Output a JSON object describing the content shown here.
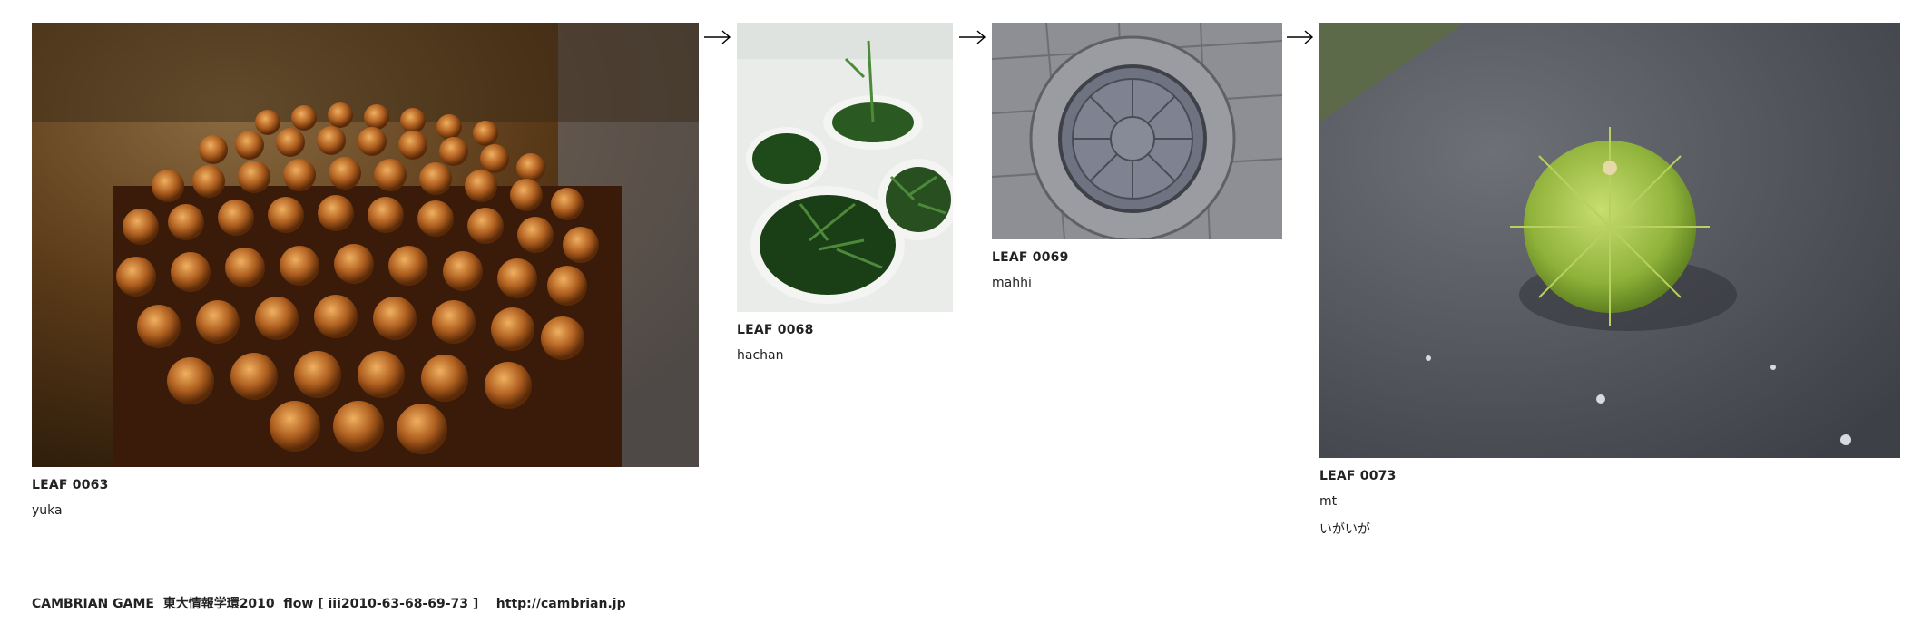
{
  "leaves": [
    {
      "id": "LEAF 0063",
      "author": "yuka",
      "photo": "wooden-chopsticks-photo"
    },
    {
      "id": "LEAF 0068",
      "author": "hachan",
      "photo": "potted-plants-photo"
    },
    {
      "id": "LEAF 0069",
      "author": "mahhi",
      "photo": "manhole-cover-photo"
    },
    {
      "id": "LEAF 0073",
      "author": "mt",
      "note": "いがいが",
      "photo": "chestnut-burr-photo"
    }
  ],
  "footer": {
    "text": "CAMBRIAN GAME  東大情報学環2010  flow [ iii2010-63-68-69-73 ]    http://cambrian.jp"
  },
  "icons": {
    "arrow": "right-arrow-icon"
  }
}
